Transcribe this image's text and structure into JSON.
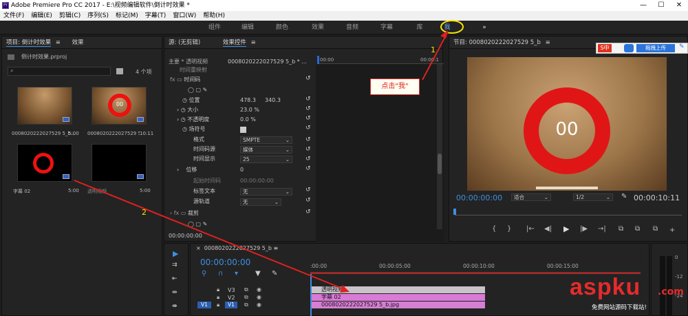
{
  "app": {
    "title": "Adobe Premiere Pro CC 2017 - E:\\视频编辑软件\\倒计时效果 *",
    "min": "—",
    "max": "☐",
    "close": "✕"
  },
  "menu": [
    "文件(F)",
    "编辑(E)",
    "剪辑(C)",
    "序列(S)",
    "标记(M)",
    "字幕(T)",
    "窗口(W)",
    "帮助(H)"
  ],
  "workspaces": [
    "组件",
    "编辑",
    "颜色",
    "效果",
    "音频",
    "字幕",
    "库",
    "我",
    "»"
  ],
  "project": {
    "tab_label": "项目: 倒计时效果",
    "tab2_label": "效果",
    "file": "倒计时效果.prproj",
    "item_count": "4 个项",
    "items": [
      {
        "name": "0008020222027529 5_b....",
        "dur": "5:00"
      },
      {
        "name": "0008020222027529 5_b.jpg",
        "dur": "10:11",
        "ring_label": "00"
      },
      {
        "name": "字幕 02",
        "dur": "5:00"
      },
      {
        "name": "透明视频",
        "dur": "5:00"
      }
    ]
  },
  "effects": {
    "source_tab": "源: (无剪辑)",
    "controls_tab": "效果控件",
    "master": "主要 * 透明视频",
    "clip": "0008020222027529 5_b * ...",
    "ruler_start": "00:00",
    "ruler_end": "00:00:1",
    "rows": {
      "remap": "时间重映射",
      "timecode": "时间码",
      "position": "位置",
      "pos_x": "478.3",
      "pos_y": "340.3",
      "scale": "大小",
      "scale_val": "23.0 %",
      "opacity": "不透明度",
      "opacity_val": "0.0 %",
      "field": "场符号",
      "format": "格式",
      "format_val": "SMPTE",
      "source": "时间码源",
      "source_val": "媒体",
      "display": "时间显示",
      "display_val": "25",
      "offset": "位移",
      "offset_val": "0",
      "start_tc": "起始时间码",
      "start_tc_val": "00:00:00:00",
      "label_text": "标签文本",
      "label_val": "无",
      "src_track": "源轨道",
      "src_track_val": "无",
      "crop": "裁剪"
    },
    "footer_tc": "00:00:00:00"
  },
  "program": {
    "tab": "节目: 0008020222027529 5_b",
    "ring_number": "00",
    "tc_left": "00:00:00:00",
    "fit": "适合",
    "quality": "1/2",
    "tc_right": "00:00:10:11",
    "toolbar": [
      "{",
      "}",
      "|←",
      "◀|",
      "▶",
      "|▶",
      "→|",
      "⧉",
      "⧉",
      "⧉",
      "+"
    ]
  },
  "timeline": {
    "tab": "0008020222027529 5_b",
    "tc": "00:00:00:00",
    "ruler": [
      ":00:00",
      "00:00:05:00",
      "00:00:10:00",
      "00:00:15:00"
    ],
    "tracks": [
      {
        "name": "V3",
        "target": ""
      },
      {
        "name": "V2",
        "target": ""
      },
      {
        "name": "V1",
        "target": "V1"
      }
    ],
    "clips": [
      {
        "label": "透明视频",
        "color": "#c9c3c9"
      },
      {
        "label": "字幕 02",
        "color": "#d97ad6"
      },
      {
        "label": "0008020222027529 5_b.jpg",
        "color": "#d57fd2"
      }
    ],
    "meter": [
      "0",
      "-12",
      "-24"
    ]
  },
  "annotations": {
    "callout": "点击\"我\"",
    "num1": "1",
    "num2": "2"
  },
  "overlay": {
    "sogou": "S中",
    "upload": "拖拽上传",
    "watermark_main": "aspku",
    "watermark_tld": ".com",
    "watermark_sub": "免费网站源码下载站!"
  }
}
